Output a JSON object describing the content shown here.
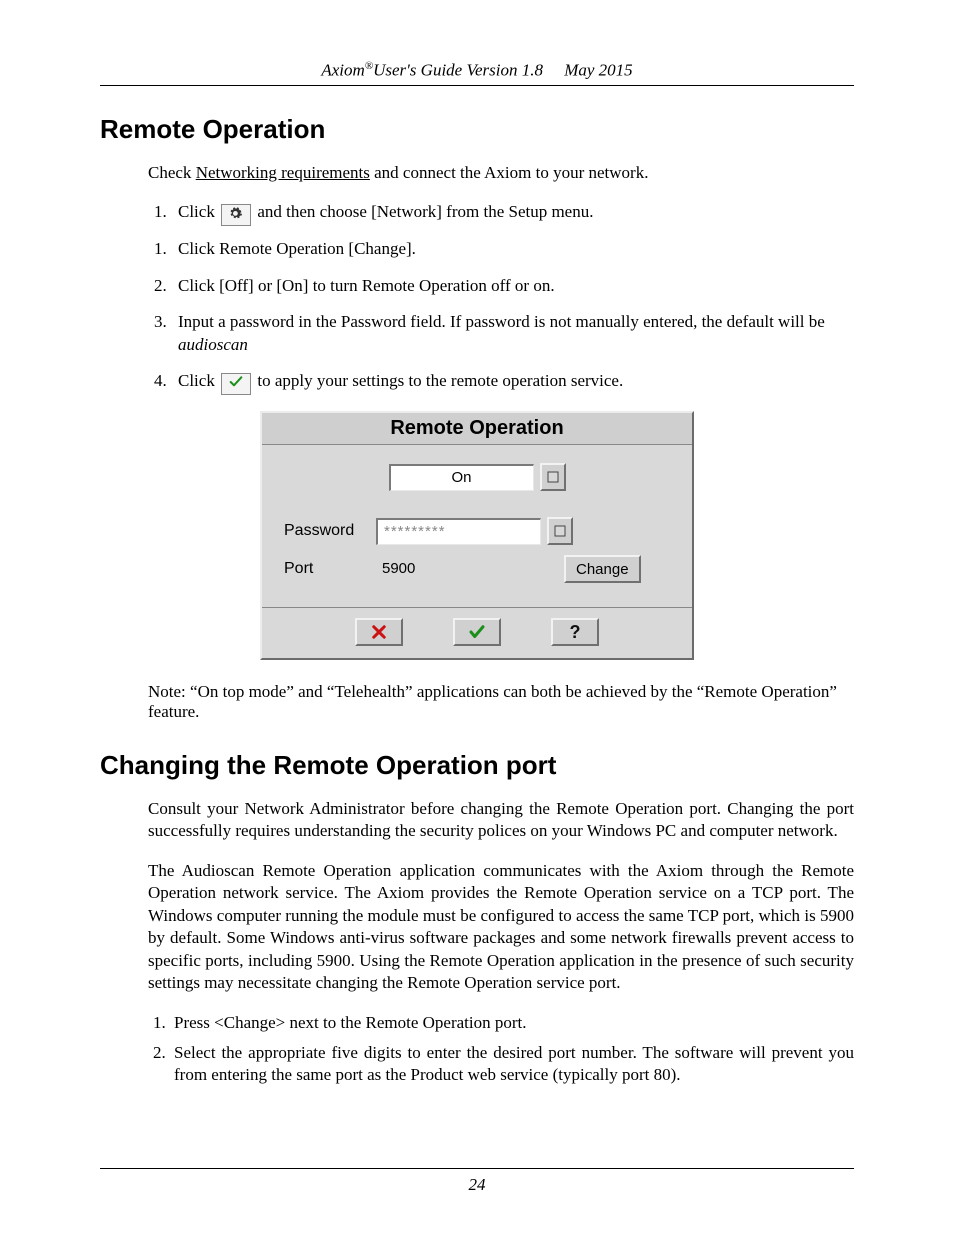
{
  "header": {
    "product": "Axiom",
    "guide_suffix": "User's Guide Version 1.8",
    "date": "May  2015"
  },
  "section1": {
    "title": "Remote Operation",
    "intro_pre": "Check ",
    "intro_link": "Networking requirements",
    "intro_post": " and connect the Axiom to your network.",
    "steps": [
      {
        "num": "1.",
        "pre": "Click ",
        "post": " and then choose [Network] from the Setup menu.",
        "icon": "gear"
      },
      {
        "num": "1.",
        "text": "Click Remote Operation  [Change]."
      },
      {
        "num": "2.",
        "text": "Click [Off] or [On] to turn Remote Operation off or on."
      },
      {
        "num": "3.",
        "pre": "Input a password in the Password field. If password is not manually entered, the default will be ",
        "em": "audioscan"
      },
      {
        "num": "4.",
        "pre": "Click ",
        "post": " to apply your settings to the remote operation service.",
        "icon": "check"
      }
    ],
    "note": "Note: “On top mode” and “Telehealth” applications can both be achieved by the “Remote Operation” feature."
  },
  "dialog": {
    "title": "Remote Operation",
    "state_value": "On",
    "password_label": "Password",
    "password_value": "*********",
    "port_label": "Port",
    "port_value": "5900",
    "change_label": "Change"
  },
  "section2": {
    "title": "Changing the Remote Operation port",
    "p1": "Consult your Network Administrator before changing the Remote Operation port. Changing the port successfully requires understanding the security polices on your Windows PC and computer network.",
    "p2": "The Audioscan Remote Operation application communicates with the Axiom through the Remote Operation network service.  The Axiom provides the Remote Operation service on a TCP port.  The Windows computer running the module must be configured to access the same TCP port, which is 5900 by default.  Some Windows anti-virus software packages and some network firewalls prevent access to specific ports, including 5900. Using the Remote Operation application in the presence of such security settings may necessitate changing the Remote Operation service port.",
    "steps": [
      "Press <Change> next to the Remote Operation port.",
      "Select the appropriate five digits to enter the desired port number.  The software will prevent you from entering the same port as the Product web service (typically port 80)."
    ]
  },
  "page_number": "24"
}
